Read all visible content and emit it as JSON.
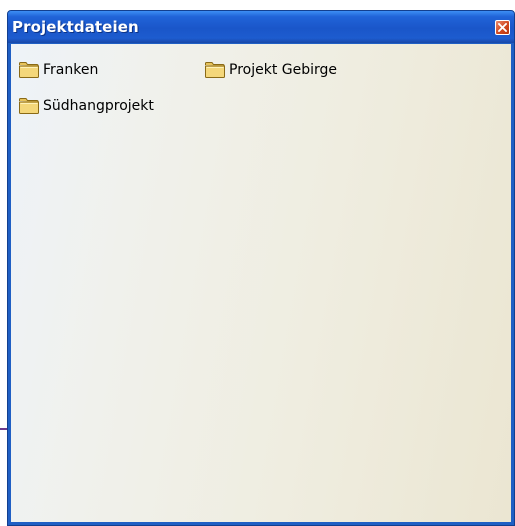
{
  "window": {
    "title": "Projektdateien",
    "close_icon": "close-icon",
    "accent_color": "#1f5fc4",
    "close_color": "#d2481f"
  },
  "folders": [
    {
      "label": "Franken",
      "icon": "folder-icon"
    },
    {
      "label": "Projekt Gebirge",
      "icon": "folder-icon"
    },
    {
      "label": "Südhangprojekt",
      "icon": "folder-icon"
    }
  ]
}
